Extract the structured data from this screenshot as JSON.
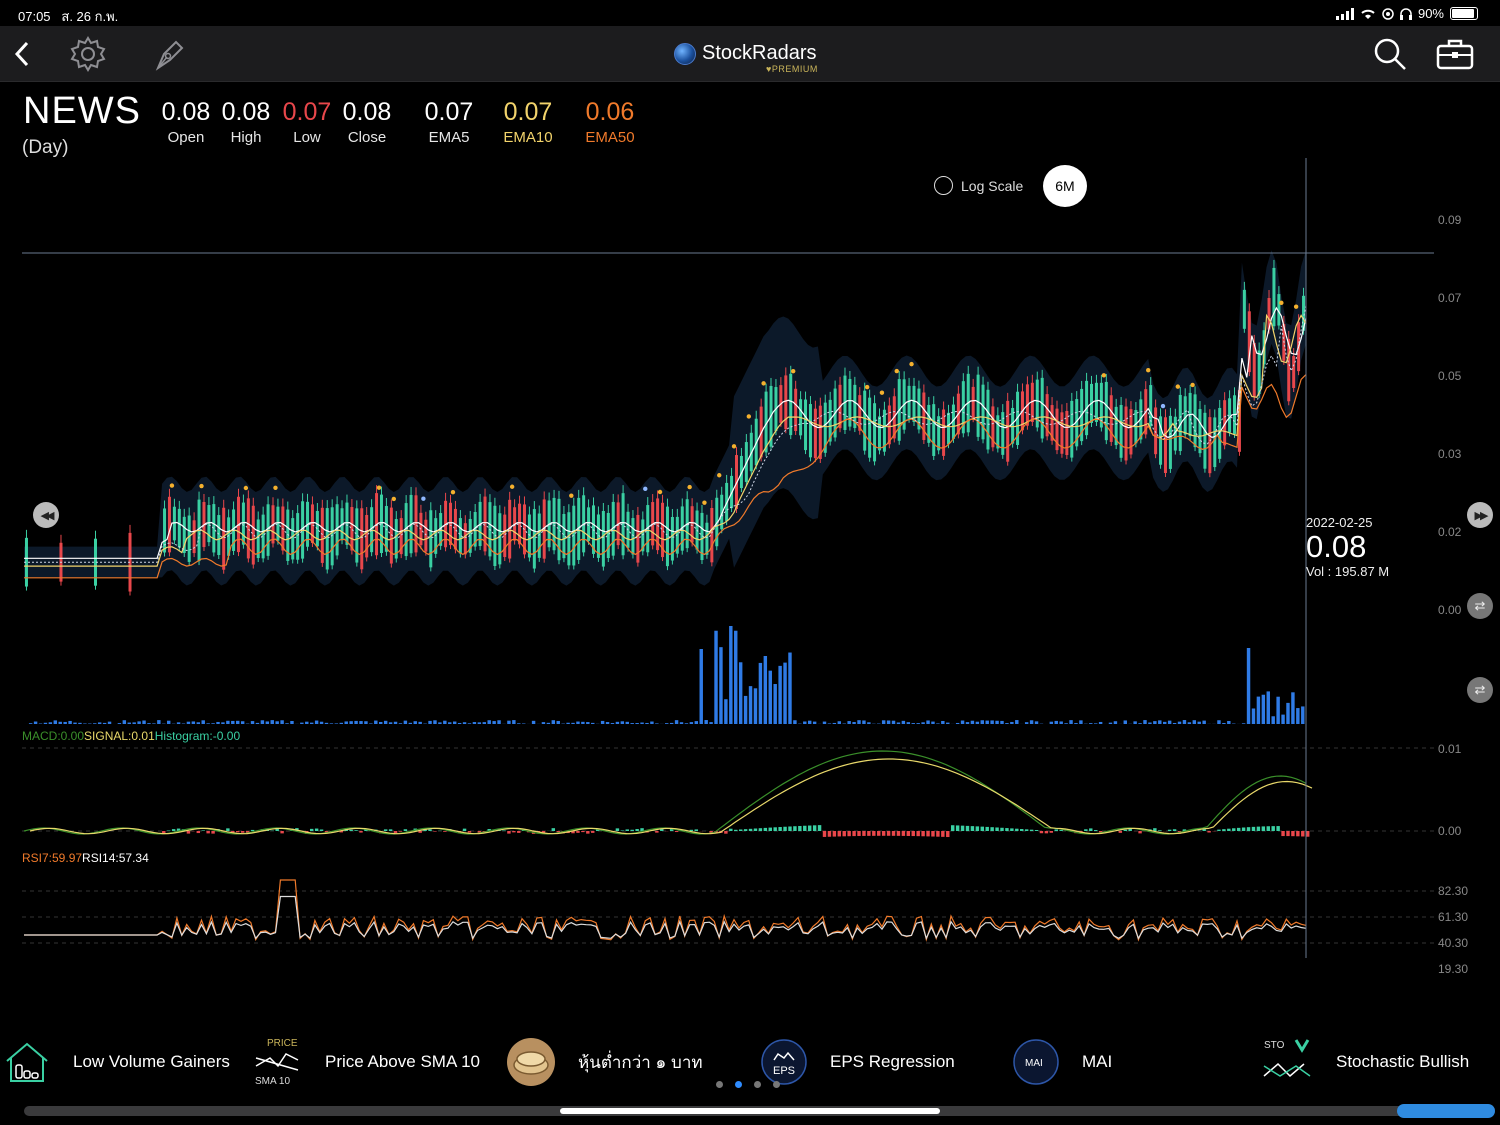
{
  "status": {
    "time": "07:05",
    "date": "ส. 26 ก.พ.",
    "battery": "90%"
  },
  "app": {
    "name": "StockRadars",
    "tier": "♥PREMIUM"
  },
  "header": {
    "ticker": "NEWS",
    "period": "(Day)",
    "stats": [
      {
        "value": "0.08",
        "label": "Open",
        "color": "#ffffff"
      },
      {
        "value": "0.08",
        "label": "High",
        "color": "#ffffff"
      },
      {
        "value": "0.07",
        "label": "Low",
        "color": "#e8474b"
      },
      {
        "value": "0.08",
        "label": "Close",
        "color": "#ffffff"
      },
      {
        "value": "0.07",
        "label": "EMA5",
        "color": "#ffffff"
      },
      {
        "value": "0.07",
        "label": "EMA10",
        "color": "#f2d36b"
      },
      {
        "value": "0.06",
        "label": "EMA50",
        "color": "#f07a2b"
      }
    ]
  },
  "controls": {
    "log_scale": "Log Scale",
    "range": "6M"
  },
  "crosshair": {
    "date": "2022-02-25",
    "price": "0.08",
    "volume": "Vol    : 195.87 M"
  },
  "price_axis": [
    "0.09",
    "0.07",
    "0.05",
    "0.03",
    "0.02",
    "0.00"
  ],
  "macd": {
    "macd_label": "MACD:0.00",
    "signal_label": "SIGNAL:0.01",
    "hist_label": "Histogram:-0.00",
    "axis": [
      "0.01",
      "0.00"
    ]
  },
  "rsi": {
    "rsi7_label": "RSI7:59.97",
    "rsi14_label": "RSI14:57.34",
    "axis": [
      "82.30",
      "61.30",
      "40.30",
      "19.30"
    ]
  },
  "colors": {
    "up": "#3ad0a3",
    "down": "#e8474b",
    "volume": "#2f7be6",
    "ema5": "#ffffff",
    "ema10": "#f2d36b",
    "ema50": "#f07a2b",
    "band": "#0d1a2b",
    "signal_dot": "#f5b12e",
    "macd_line": "#3a8f2a",
    "signal_line": "#e8d86a",
    "rsi7": "#f07a2b",
    "rsi14": "#dddddd"
  },
  "bottom_scans": [
    {
      "label": "Low Volume Gainers",
      "icon": "house-bars-icon"
    },
    {
      "label": "Price Above SMA  10",
      "icon": "price-sma-cross-icon",
      "icon_top": "PRICE",
      "icon_bottom": "SMA    10"
    },
    {
      "label": "หุ้นต่ำกว่า ๑ บาท",
      "icon": "coin-stack-icon"
    },
    {
      "label": "EPS Regression",
      "icon": "eps-icon",
      "icon_text": "EPS"
    },
    {
      "label": "MAI",
      "icon": "mai-icon",
      "icon_text": "MAI"
    },
    {
      "label": "Stochastic Bullish",
      "icon": "sto-bull-icon",
      "icon_text": "STO"
    }
  ]
}
